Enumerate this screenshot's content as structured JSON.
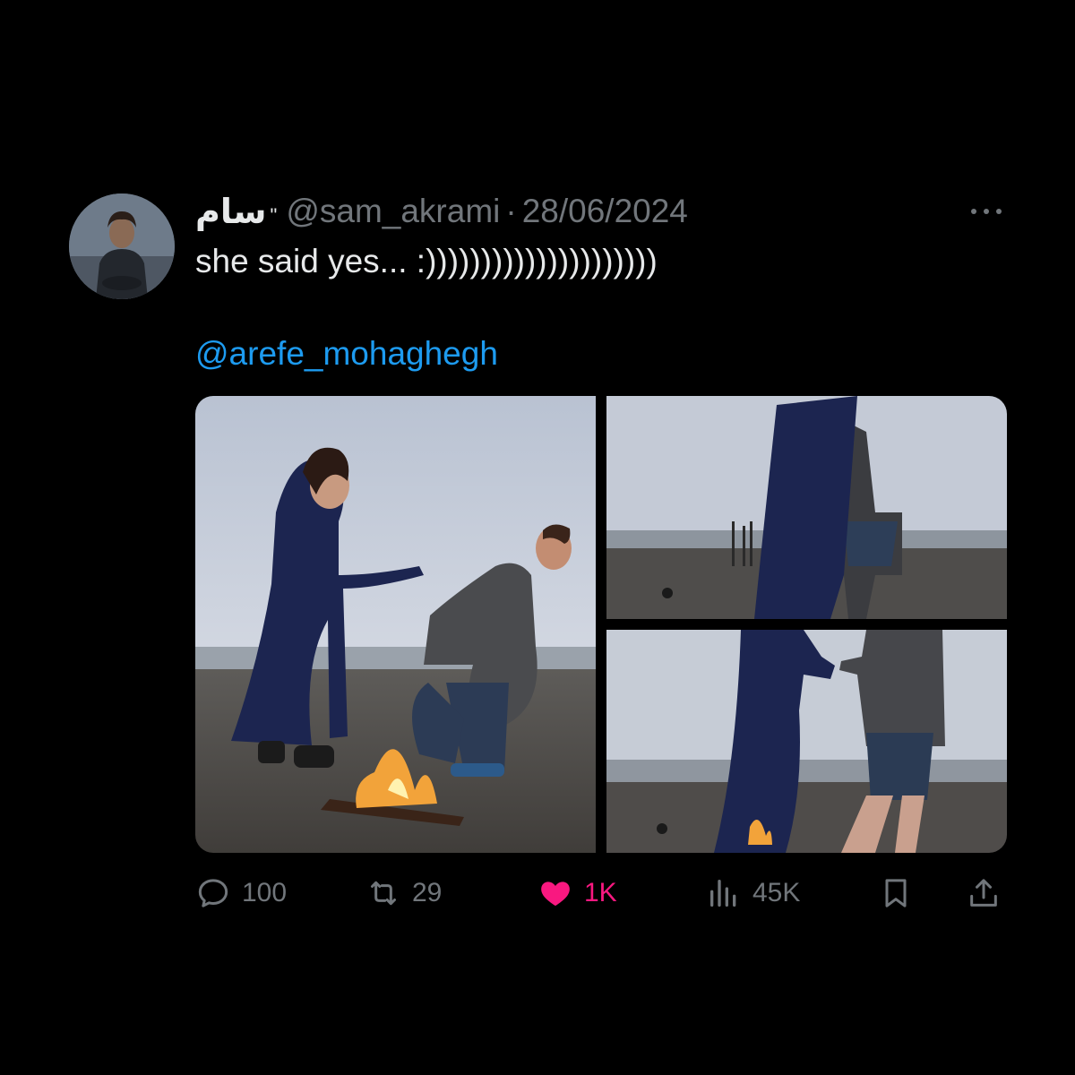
{
  "tweet": {
    "display_name": "سام",
    "quote_mark": "\"",
    "handle": "@sam_akrami",
    "separator": "·",
    "date": "28/06/2024",
    "text": "she said yes... :)))))))))))))))))))))",
    "mention": "@arefe_mohaghegh"
  },
  "actions": {
    "reply_count": "100",
    "retweet_count": "29",
    "like_count": "1K",
    "views_count": "45K"
  },
  "colors": {
    "background": "#000000",
    "text": "#e7e9ea",
    "muted": "#71767b",
    "link": "#1d9bf0",
    "like": "#f91880"
  },
  "icons": [
    "more-icon",
    "reply-icon",
    "retweet-icon",
    "like-icon",
    "views-icon",
    "bookmark-icon",
    "share-icon"
  ]
}
